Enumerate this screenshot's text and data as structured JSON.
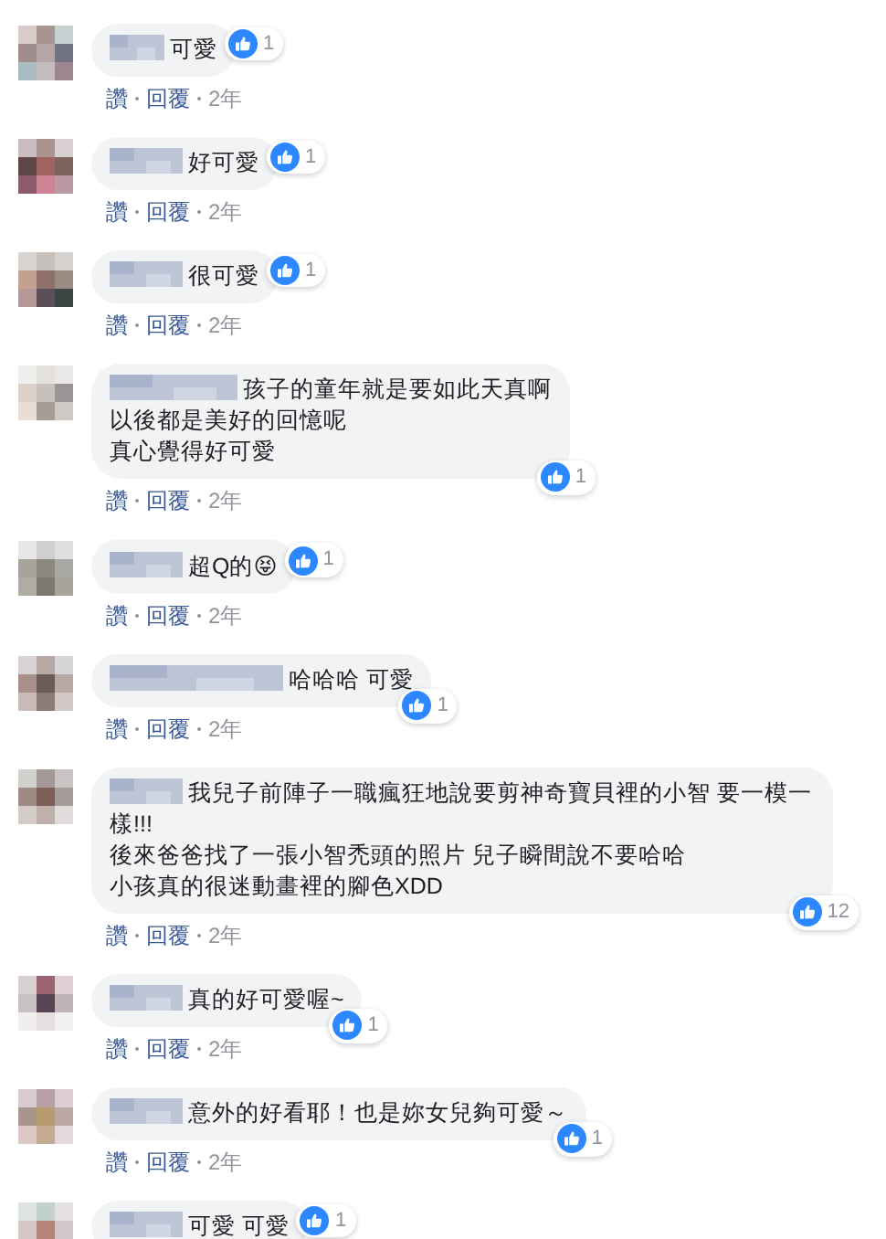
{
  "comments": [
    {
      "text": "可愛",
      "kind": "inline",
      "likes": "1",
      "actions": [
        "讚",
        "回覆"
      ],
      "time": "2年"
    },
    {
      "text": "好可愛",
      "kind": "inline",
      "likes": "1",
      "actions": [
        "讚",
        "回覆"
      ],
      "time": "2年"
    },
    {
      "text": "很可愛",
      "kind": "inline",
      "likes": "1",
      "actions": [
        "讚",
        "回覆"
      ],
      "time": "2年"
    },
    {
      "text": "孩子的童年就是要如此天真啊",
      "more_lines": [
        "以後都是美好的回憶呢",
        "真心覺得好可愛"
      ],
      "kind": "corner",
      "likes": "1",
      "actions": [
        "讚",
        "回覆"
      ],
      "time": "2年"
    },
    {
      "text": "超Q的",
      "emoji": "😝",
      "kind": "inline",
      "likes": "1",
      "actions": [
        "讚",
        "回覆"
      ],
      "time": "2年"
    },
    {
      "text": "哈哈哈 可愛",
      "kind": "corner",
      "likes": "1",
      "actions": [
        "讚",
        "回覆"
      ],
      "time": "2年"
    },
    {
      "text": "我兒子前陣子一職瘋狂地說要剪神奇寶貝裡的小智 要一模一樣!!!",
      "more_lines": [
        "後來爸爸找了一張小智禿頭的照片 兒子瞬間說不要哈哈",
        "小孩真的很迷動畫裡的腳色XDD"
      ],
      "kind": "corner",
      "likes": "12",
      "actions": [
        "讚",
        "回覆"
      ],
      "time": "2年"
    },
    {
      "text": "真的好可愛喔~",
      "kind": "corner",
      "likes": "1",
      "actions": [
        "讚",
        "回覆"
      ],
      "time": "2年"
    },
    {
      "text": "意外的好看耶！也是妳女兒夠可愛～",
      "kind": "corner",
      "likes": "1",
      "actions": [
        "讚",
        "回覆"
      ],
      "time": "2年"
    },
    {
      "text": "可愛 可愛",
      "kind": "inline",
      "likes": "1"
    }
  ]
}
